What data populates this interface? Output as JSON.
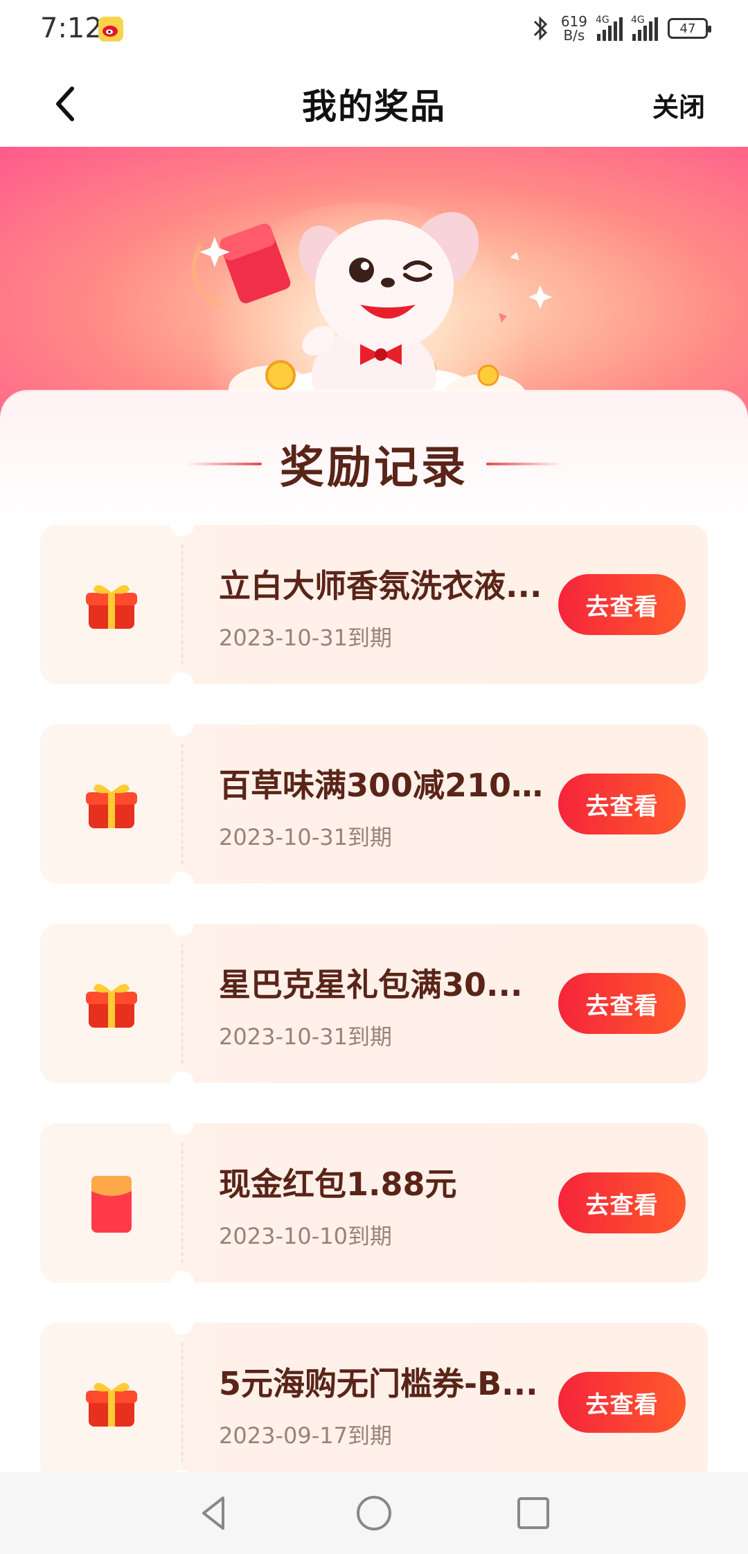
{
  "status_bar": {
    "time": "7:12",
    "net_speed_value": "619",
    "net_speed_unit": "B/s",
    "signal_1_label": "4G",
    "signal_2_label": "4G",
    "battery": "47"
  },
  "nav": {
    "title": "我的奖品",
    "close_label": "关闭"
  },
  "section": {
    "title": "奖励记录"
  },
  "button_label": "去查看",
  "prizes": [
    {
      "name": "立白大师香氛洗衣液...",
      "expiry": "2023-10-31到期",
      "icon": "gift-box-icon"
    },
    {
      "name": "百草味满300减210...",
      "expiry": "2023-10-31到期",
      "icon": "gift-box-icon"
    },
    {
      "name": "星巴克星礼包满30...",
      "expiry": "2023-10-31到期",
      "icon": "gift-box-icon"
    },
    {
      "name": "现金红包1.88元",
      "expiry": "2023-10-10到期",
      "icon": "red-packet-icon"
    },
    {
      "name": "5元海购无门槛券-B...",
      "expiry": "2023-09-17到期",
      "icon": "gift-box-icon"
    }
  ],
  "colors": {
    "accent_button_start": "#f5253b",
    "accent_button_end": "#ff5a2c",
    "prize_title": "#5a2418",
    "banner_pink": "#ff5a8c"
  }
}
